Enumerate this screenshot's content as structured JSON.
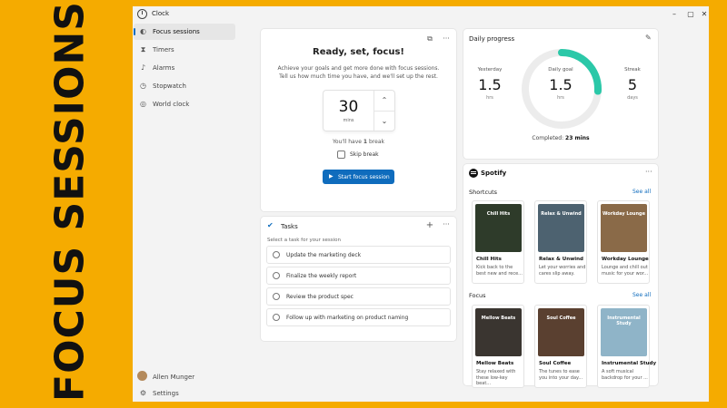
{
  "banner": {
    "text": "FOCUS SESSIONS"
  },
  "window": {
    "title": "Clock"
  },
  "sidebar": {
    "items": [
      {
        "label": "Focus sessions",
        "icon": "focus-icon",
        "active": true
      },
      {
        "label": "Timers",
        "icon": "hourglass-icon"
      },
      {
        "label": "Alarms",
        "icon": "bell-icon"
      },
      {
        "label": "Stopwatch",
        "icon": "stopwatch-icon"
      },
      {
        "label": "World clock",
        "icon": "globe-icon"
      }
    ],
    "user": "Allen Munger",
    "settings": "Settings"
  },
  "focus": {
    "title": "Ready, set, focus!",
    "description": "Achieve your goals and get more done with focus sessions. Tell us how much time you have, and we'll set up the rest.",
    "minutes": "30",
    "unit": "mins",
    "break_note_prefix": "You'll have ",
    "break_count": "1",
    "break_note_suffix": " break",
    "skip_label": "Skip break",
    "start_label": "Start focus session"
  },
  "tasks": {
    "title": "Tasks",
    "hint": "Select a task for your session",
    "items": [
      "Update the marketing deck",
      "Finalize the weekly report",
      "Review the product spec",
      "Follow up with marketing on product naming"
    ]
  },
  "progress": {
    "title": "Daily progress",
    "yesterday": {
      "label": "Yesterday",
      "value": "1.5",
      "unit": "hrs"
    },
    "goal": {
      "label": "Daily goal",
      "value": "1.5",
      "unit": "hrs"
    },
    "streak": {
      "label": "Streak",
      "value": "5",
      "unit": "days"
    },
    "goal_fraction": 0.26,
    "completed_prefix": "Completed: ",
    "completed_value": "23 mins",
    "accent": "#2bc8a8"
  },
  "spotify": {
    "brand": "Spotify",
    "shortcuts_label": "Shortcuts",
    "focus_label": "Focus",
    "see_all": "See all",
    "shortcuts": [
      {
        "name": "Chill Hits",
        "art_text": "Chill Hits",
        "desc": "Kick back to the best new and rece...",
        "color": "#2e3b2a"
      },
      {
        "name": "Relax & Unwind",
        "art_text": "Relax & Unwind",
        "desc": "Let your worries and cares slip away.",
        "color": "#4d6270"
      },
      {
        "name": "Workday Lounge",
        "art_text": "Workday Lounge",
        "desc": "Lounge and chill out music for your wor...",
        "color": "#8a6a48"
      }
    ],
    "focus": [
      {
        "name": "Mellow Beats",
        "art_text": "Mellow Beats",
        "desc": "Stay relaxed with these low-key beat...",
        "color": "#3a3530"
      },
      {
        "name": "Soul Coffee",
        "art_text": "Soul Coffee",
        "desc": "The tunes to ease you into your day...",
        "color": "#5a4030"
      },
      {
        "name": "Instrumental Study",
        "art_text": "Instrumental Study",
        "desc": "A soft musical backdrop for your ...",
        "color": "#8fb4c8"
      }
    ]
  }
}
